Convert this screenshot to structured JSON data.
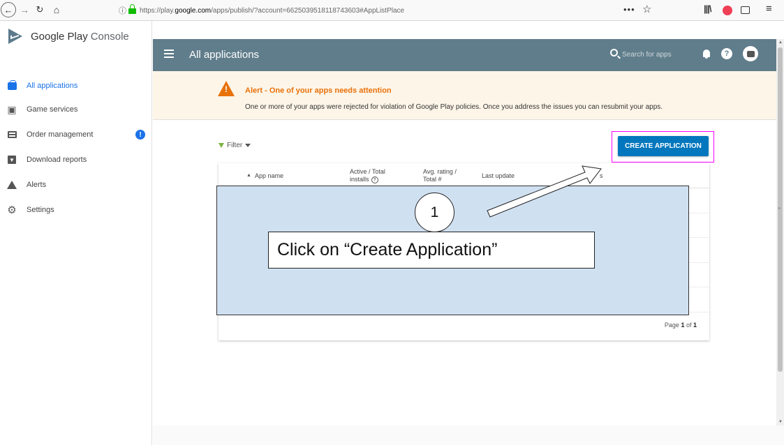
{
  "browser": {
    "url_prefix": "https://play.",
    "url_domain": "google.com",
    "url_suffix": "/apps/publish/?account=6625039518118743603#AppListPlace",
    "url_actions": "•••"
  },
  "sidebar": {
    "brand_title": "Google Play",
    "brand_sub": "Console",
    "items": [
      {
        "label": "All applications",
        "icon": "apps-icon"
      },
      {
        "label": "Game services",
        "icon": "game-icon"
      },
      {
        "label": "Order management",
        "icon": "order-icon"
      },
      {
        "label": "Download reports",
        "icon": "download-icon"
      },
      {
        "label": "Alerts",
        "icon": "alert-icon"
      },
      {
        "label": "Settings",
        "icon": "gear-icon"
      }
    ],
    "order_badge": "!"
  },
  "header": {
    "title": "All applications",
    "search_placeholder": "Search for apps"
  },
  "alert": {
    "title": "Alert - One of your apps needs attention",
    "message": "One or more of your apps were rejected for violation of Google Play policies. Once you address the issues you can resubmit your apps."
  },
  "toolbar": {
    "filter_label": "Filter",
    "create_label": "CREATE APPLICATION"
  },
  "table": {
    "columns": [
      {
        "line1": "App name",
        "line2": ""
      },
      {
        "line1": "Active / Total",
        "line2": "installs"
      },
      {
        "line1": "Avg. rating /",
        "line2": "Total #"
      },
      {
        "line1": "Last update",
        "line2": ""
      },
      {
        "line1": "s",
        "line2": ""
      }
    ],
    "pager_prefix": "Page ",
    "pager_current": "1",
    "pager_mid": " of ",
    "pager_total": "1"
  },
  "overlay": {
    "step": "1",
    "instruction": "Click on “Create Application”"
  },
  "colors": {
    "header_bg": "#607d8b",
    "accent": "#0277bd",
    "alert_orange": "#e8710a",
    "highlight": "#ff00ff",
    "overlay_bg": "#cfe0f1"
  }
}
